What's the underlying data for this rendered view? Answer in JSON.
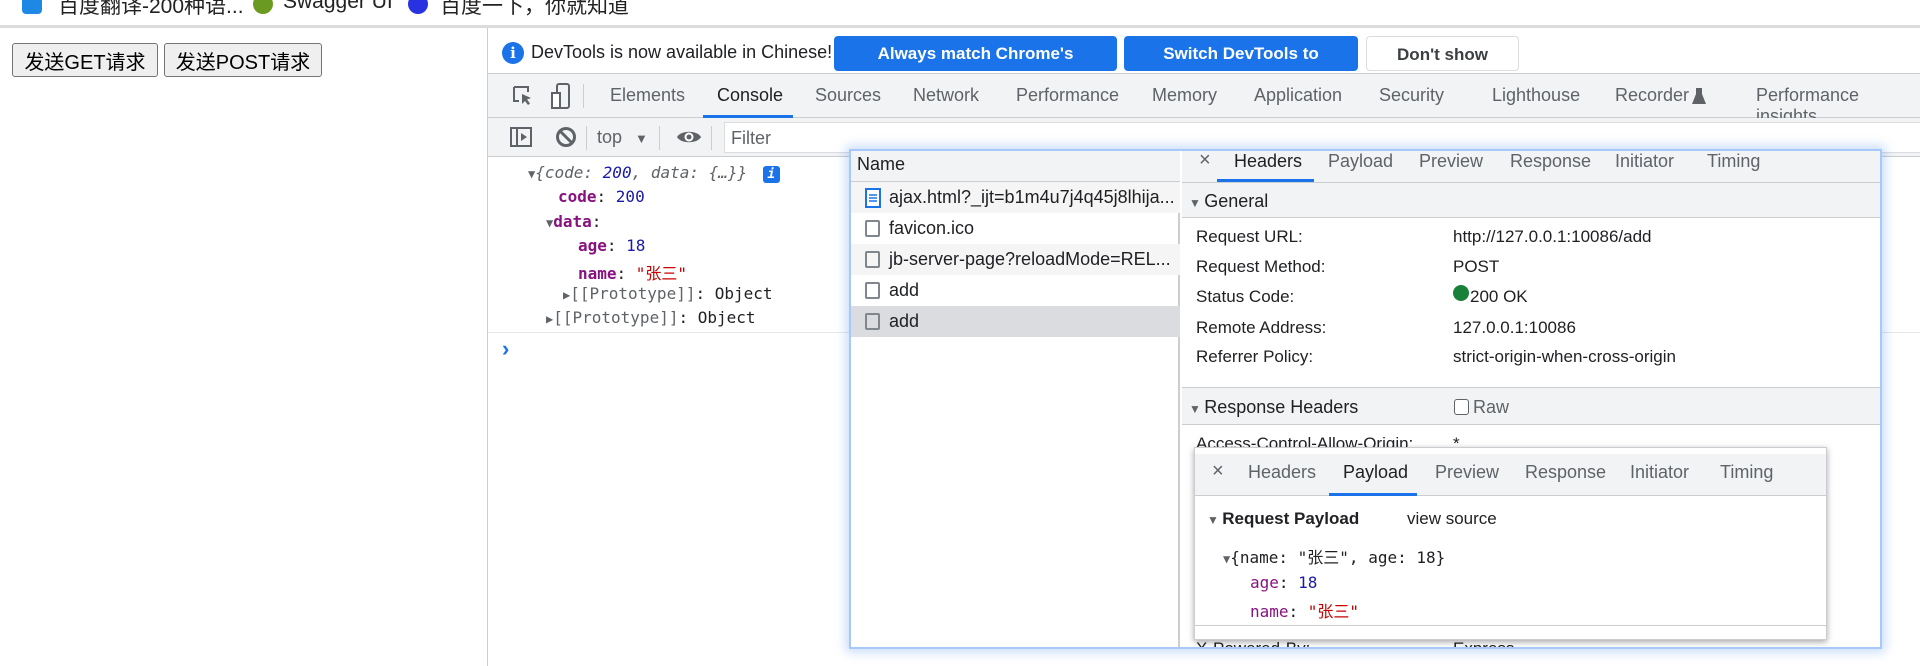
{
  "bookmarks": [
    {
      "label": "百度翻译-200种语...",
      "icon": "baidu-translate-icon",
      "color": "#1e88e5"
    },
    {
      "label": "Swagger UI",
      "icon": "swagger-icon",
      "color": "#6a9a1f"
    },
    {
      "label": "百度一下，你就知道",
      "icon": "baidu-paw-icon",
      "color": "#2932e1"
    }
  ],
  "page": {
    "get_button": "发送GET请求",
    "post_button": "发送POST请求"
  },
  "devtools": {
    "banner": {
      "text": "DevTools is now available in Chinese!",
      "always_match": "Always match Chrome's language",
      "switch": "Switch DevTools to Chinese",
      "dont_show": "Don't show again"
    },
    "tabs": [
      "Elements",
      "Console",
      "Sources",
      "Network",
      "Performance",
      "Memory",
      "Application",
      "Security",
      "Lighthouse",
      "Recorder",
      "Performance insights"
    ],
    "active_tab": "Console",
    "console_toolbar": {
      "context": "top",
      "filter_placeholder": "Filter"
    },
    "console": {
      "summary_open": "{",
      "summary_code_key": "code",
      "summary_code_val": "200",
      "summary_data_key": "data",
      "summary_data_val": "{…}",
      "code_key": "code",
      "code_val": "200",
      "data_key": "data",
      "age_key": "age",
      "age_val": "18",
      "name_key": "name",
      "name_val": "\"张三\"",
      "proto_key": "[[Prototype]]",
      "proto_val": "Object",
      "prompt": "›"
    },
    "network": {
      "name_header": "Name",
      "requests": [
        {
          "name": "ajax.html?_ijt=b1m4u7j4q45j8lhija...",
          "type": "document"
        },
        {
          "name": "favicon.ico",
          "type": "other"
        },
        {
          "name": "jb-server-page?reloadMode=REL...",
          "type": "other"
        },
        {
          "name": "add",
          "type": "other"
        },
        {
          "name": "add",
          "type": "other",
          "selected": true
        }
      ],
      "detail_tabs": [
        "Headers",
        "Payload",
        "Preview",
        "Response",
        "Initiator",
        "Timing"
      ],
      "active_detail_tab": "Headers",
      "general": {
        "title": "General",
        "rows": [
          {
            "label": "Request URL:",
            "value": "http://127.0.0.1:10086/add"
          },
          {
            "label": "Request Method:",
            "value": "POST"
          },
          {
            "label": "Status Code:",
            "value": "200 OK",
            "status_color": "#188038"
          },
          {
            "label": "Remote Address:",
            "value": "127.0.0.1:10086"
          },
          {
            "label": "Referrer Policy:",
            "value": "strict-origin-when-cross-origin"
          }
        ]
      },
      "response_headers": {
        "title": "Response Headers",
        "raw_label": "Raw",
        "rows": [
          {
            "label": "Access-Control-Allow-Origin:",
            "value": "*"
          },
          {
            "label": "X-Powered-By:",
            "value": "Express"
          }
        ]
      },
      "payload_popup": {
        "tabs": [
          "Headers",
          "Payload",
          "Preview",
          "Response",
          "Initiator",
          "Timing"
        ],
        "active_tab": "Payload",
        "section_title": "Request Payload",
        "view_source": "view source",
        "summary": "{name: \"张三\", age: 18}",
        "age_key": "age",
        "age_val": "18",
        "name_key": "name",
        "name_val": "\"张三\""
      }
    }
  },
  "colors": {
    "accent": "#1a73e8",
    "selected_row": "#dadce0"
  }
}
